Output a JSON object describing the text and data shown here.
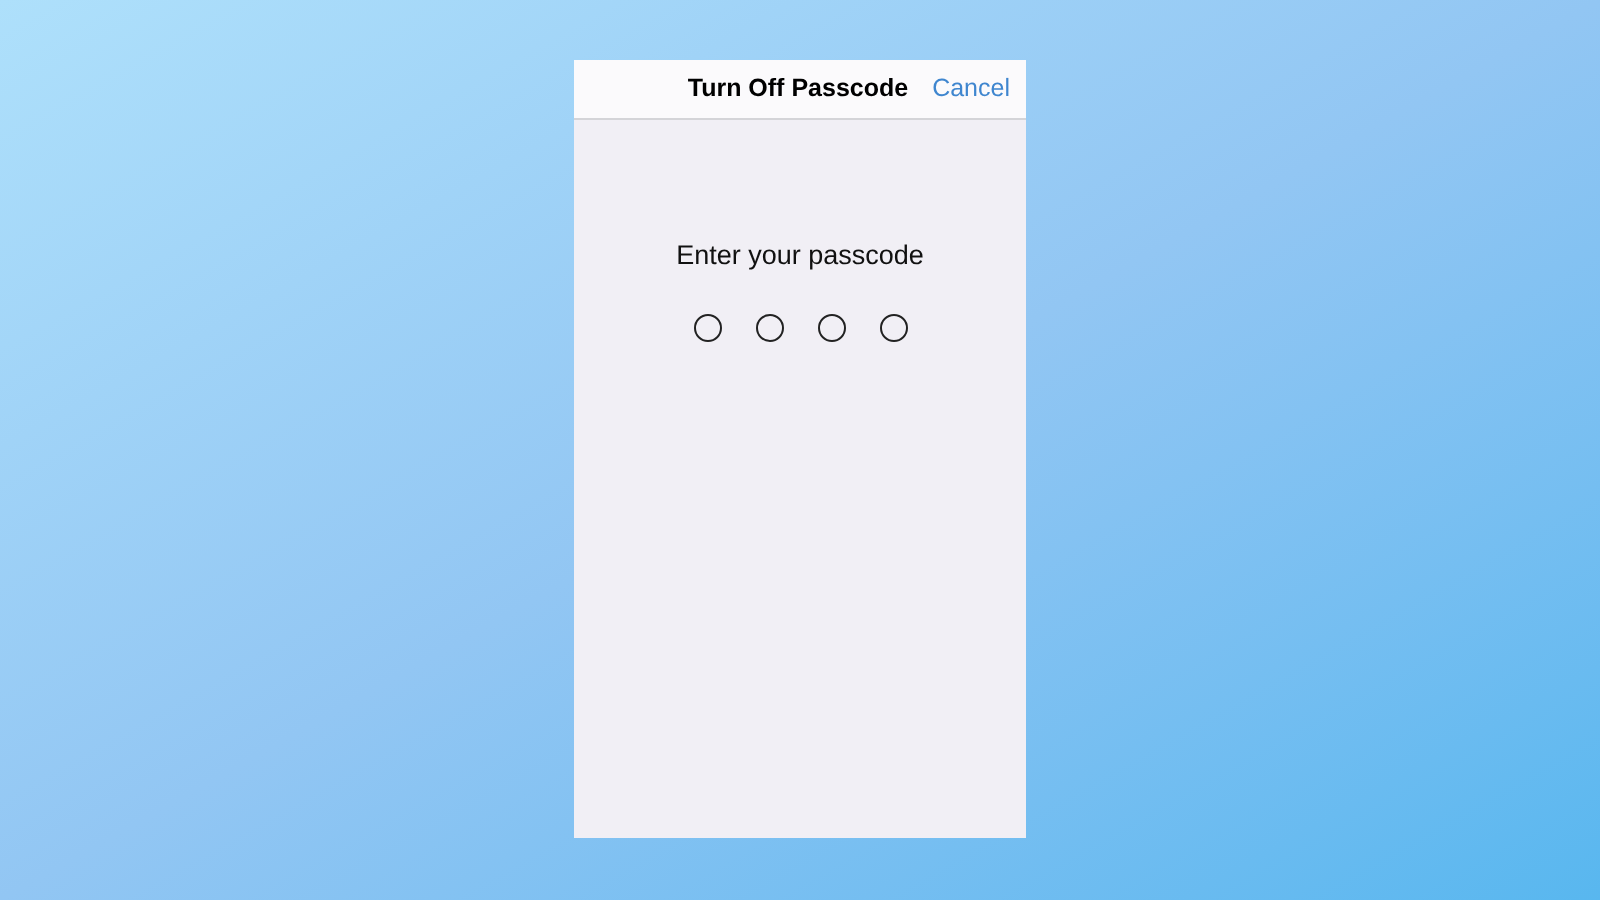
{
  "nav_bar": {
    "title": "Turn Off Passcode",
    "cancel": "Cancel"
  },
  "prompt": "Enter your passcode",
  "digits": [
    {
      "filled": false
    },
    {
      "filled": false
    },
    {
      "filled": false
    },
    {
      "filled": false
    }
  ]
}
